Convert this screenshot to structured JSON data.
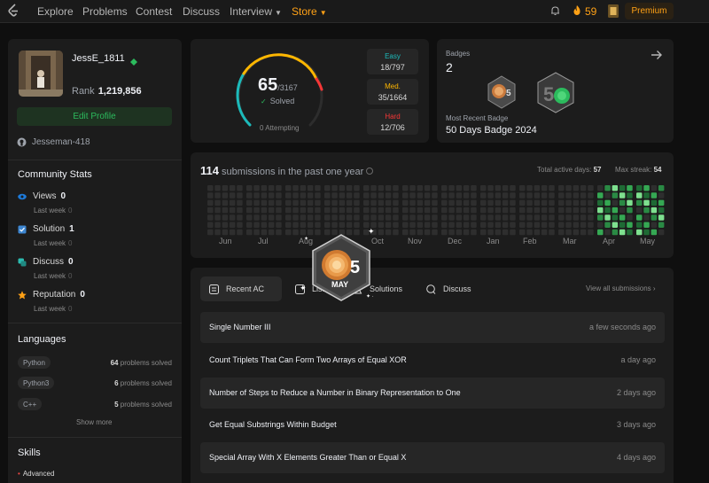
{
  "nav": {
    "items": [
      "Explore",
      "Problems",
      "Contest",
      "Discuss",
      "Interview",
      "Store"
    ],
    "streak": "59",
    "premium": "Premium"
  },
  "profile": {
    "username": "JessE_1811",
    "rank_label": "Rank",
    "rank": "1,219,856",
    "edit": "Edit Profile",
    "github": "Jesseman-418"
  },
  "community": {
    "title": "Community Stats",
    "stats": [
      {
        "label": "Views",
        "value": "0",
        "sub": "Last week",
        "delta": "0"
      },
      {
        "label": "Solution",
        "value": "1",
        "sub": "Last week",
        "delta": "0"
      },
      {
        "label": "Discuss",
        "value": "0",
        "sub": "Last week",
        "delta": "0"
      },
      {
        "label": "Reputation",
        "value": "0",
        "sub": "Last week",
        "delta": "0"
      }
    ]
  },
  "languages": {
    "title": "Languages",
    "items": [
      {
        "name": "Python",
        "count": "64",
        "suffix": "problems solved"
      },
      {
        "name": "Python3",
        "count": "6",
        "suffix": "problems solved"
      },
      {
        "name": "C++",
        "count": "5",
        "suffix": "problems solved"
      }
    ],
    "show_more": "Show more"
  },
  "skills": {
    "title": "Skills",
    "level": "Advanced"
  },
  "solved": {
    "count": "65",
    "total": "/3167",
    "label": "Solved",
    "attempting": "0 Attempting",
    "easy": {
      "label": "Easy",
      "value": "18/797",
      "color": "#1cbaba"
    },
    "medium": {
      "label": "Med.",
      "value": "35/1664",
      "color": "#ffb700"
    },
    "hard": {
      "label": "Hard",
      "value": "12/706",
      "color": "#f63737"
    }
  },
  "badges": {
    "label": "Badges",
    "count": "2",
    "recent_label": "Most Recent Badge",
    "recent_name": "50 Days Badge 2024"
  },
  "submissions": {
    "count": "114",
    "text": "submissions in the past one year",
    "active_label": "Total active days:",
    "active": "57",
    "streak_label": "Max streak:",
    "streak": "54",
    "months": [
      "Jun",
      "Jul",
      "Aug",
      "Oct",
      "Nov",
      "Dec",
      "Jan",
      "Feb",
      "Mar",
      "Apr",
      "May"
    ]
  },
  "tabs": {
    "recent": "Recent AC",
    "list": "List",
    "solutions": "Solutions",
    "discuss": "Discuss",
    "view_all": "View all submissions"
  },
  "recent_ac": [
    {
      "title": "Single Number III",
      "time": "a few seconds ago"
    },
    {
      "title": "Count Triplets That Can Form Two Arrays of Equal XOR",
      "time": "a day ago"
    },
    {
      "title": "Number of Steps to Reduce a Number in Binary Representation to One",
      "time": "2 days ago"
    },
    {
      "title": "Get Equal Substrings Within Budget",
      "time": "3 days ago"
    },
    {
      "title": "Special Array With X Elements Greater Than or Equal X",
      "time": "4 days ago"
    }
  ],
  "overlay_badge": {
    "num": "5",
    "month": "MAY"
  }
}
